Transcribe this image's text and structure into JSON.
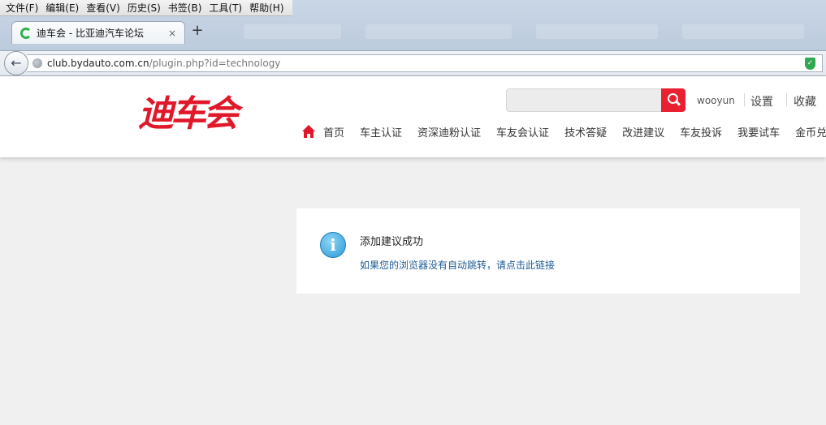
{
  "browser": {
    "menu": [
      "文件(F)",
      "编辑(E)",
      "查看(V)",
      "历史(S)",
      "书签(B)",
      "工具(T)",
      "帮助(H)"
    ],
    "tab_title": "迪车会 - 比亚迪汽车论坛",
    "tab_close": "×",
    "new_tab": "+",
    "back": "←",
    "url_domain": "club.bydauto.com.cn",
    "url_path": "/plugin.php?id=technology"
  },
  "header": {
    "logo_text": "迪车会",
    "search_placeholder": "",
    "username": "wooyun",
    "settings": "设置",
    "favorites": "收藏",
    "nav": [
      "首页",
      "车主认证",
      "资深迪粉认证",
      "车友会认证",
      "技术答疑",
      "改进建议",
      "车友投诉",
      "我要试车",
      "金币兑换"
    ]
  },
  "message": {
    "title": "添加建议成功",
    "link": "如果您的浏览器没有自动跳转，请点击此链接",
    "icon": "i"
  },
  "colors": {
    "brand_red": "#e0182a",
    "link_blue": "#1f5b96",
    "page_bg": "#f0f0f0"
  }
}
